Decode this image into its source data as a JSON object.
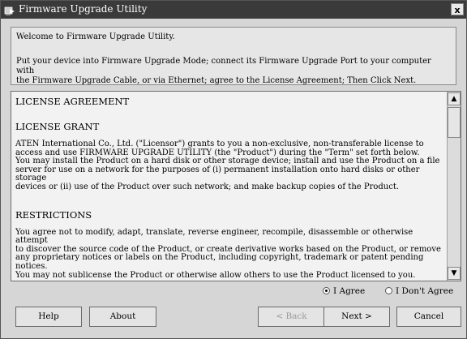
{
  "window": {
    "title": "Firmware Upgrade Utility",
    "close_glyph": "x"
  },
  "intro": {
    "welcome": "Welcome to Firmware Upgrade Utility.",
    "instructions_line1": "Put your device into Firmware Upgrade Mode; connect its Firmware Upgrade Port to your computer with",
    "instructions_line2": "the Firmware Upgrade Cable, or via Ethernet; agree to the License Agreement; Then Click Next."
  },
  "license": {
    "heading": "LICENSE AGREEMENT",
    "grant_heading": "LICENSE GRANT",
    "grant_lines": [
      "ATEN International Co., Ltd. (\"Licensor\") grants to you a non-exclusive, non-transferable license to",
      "access and use FIRMWARE UPGRADE UTILITY (the \"Product\") during the \"Term\" set forth below.",
      "You may install the Product on a hard disk or other storage device; install and use the Product on a file",
      "server for use on a network for the purposes of (i) permanent installation onto hard disks or other storage",
      "devices or (ii) use of the Product over such network; and make backup copies of the Product."
    ],
    "restrictions_heading": "RESTRICTIONS",
    "restrictions_lines": [
      "You agree not to modify, adapt, translate, reverse engineer, recompile, disassemble or otherwise attempt",
      "to discover the source code of the Product, or create derivative works based on the Product, or remove",
      "any proprietary notices or labels on the Product, including copyright, trademark or patent pending notices.",
      "You may not sublicense the Product or otherwise allow others to use the Product licensed to you."
    ],
    "scroll_up_glyph": "▲",
    "scroll_down_glyph": "▼"
  },
  "agreement": {
    "agree_label": "I Agree",
    "disagree_label": "I Don't Agree",
    "selected": "agree"
  },
  "buttons": {
    "help": "Help",
    "about": "About",
    "back": "< Back",
    "next": "Next >",
    "cancel": "Cancel"
  },
  "icons": {
    "app": "firmware-upgrade-icon",
    "close": "close-icon",
    "scroll_up": "arrow-up-icon",
    "scroll_down": "arrow-down-icon"
  },
  "colors": {
    "titlebar": "#3a3a3a",
    "window_bg": "#d6d6d6",
    "text_area": "#f2f2f2"
  }
}
